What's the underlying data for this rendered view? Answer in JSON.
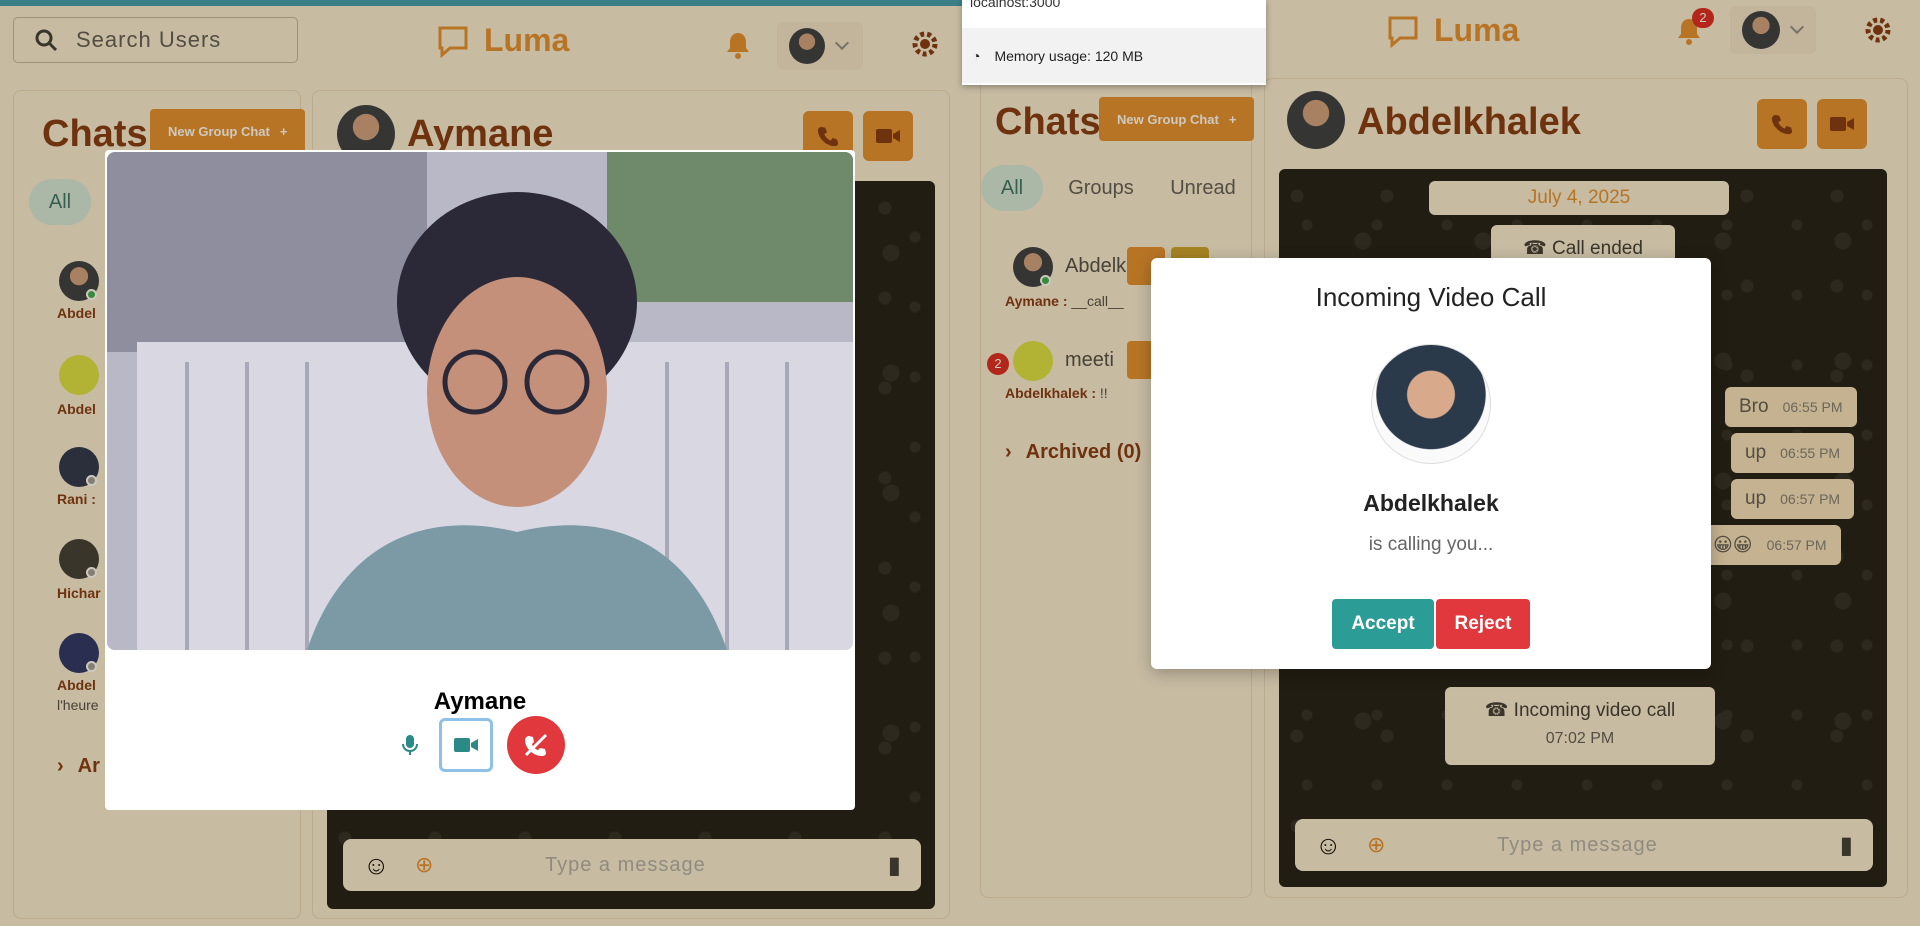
{
  "left": {
    "search_placeholder": "Search Users",
    "app_name": "Luma",
    "chats_title": "Chats",
    "new_group": "New Group Chat",
    "filters": [
      "All"
    ],
    "chat_previews": [
      {
        "name": "Abdel"
      },
      {
        "name": "Abdel"
      },
      {
        "name": "Rani :"
      },
      {
        "name": "Hichar"
      },
      {
        "name": "Abdel",
        "extra": "l'heure"
      }
    ],
    "archived": "Ar",
    "chat_name": "Aymane",
    "composer_placeholder": "Type a message"
  },
  "video_call": {
    "caller": "Aymane"
  },
  "task_popup": {
    "url": "localhost:3000",
    "memory": "Memory usage: 120 MB"
  },
  "right": {
    "app_name": "Luma",
    "notif_count": "2",
    "chats_title": "Chats",
    "new_group": "New Group Chat",
    "filters": [
      "All",
      "Groups",
      "Unread"
    ],
    "items": [
      {
        "name": "Abdelk",
        "sender": "Aymane :",
        "msg": "__call__"
      },
      {
        "name": "meeti",
        "sender": "Abdelkhalek :",
        "msg": "!!",
        "unread": "2"
      }
    ],
    "archived": "Archived (0)",
    "chat_name": "Abdelkhalek",
    "date_pill": "July 4, 2025",
    "call_ended": "Call ended",
    "messages": [
      {
        "text": "Bro",
        "time": "06:55 PM"
      },
      {
        "text": "up",
        "time": "06:55 PM"
      },
      {
        "text": "up",
        "time": "06:57 PM"
      },
      {
        "text": "😀😀",
        "time": "06:57 PM"
      }
    ],
    "incoming_sys": "Incoming video call",
    "incoming_sys_time": "07:02 PM",
    "composer_placeholder": "Type a message"
  },
  "incoming_modal": {
    "title": "Incoming Video Call",
    "caller": "Abdelkhalek",
    "subtitle": "is calling you...",
    "accept": "Accept",
    "reject": "Reject"
  },
  "colors": {
    "accent": "#e08a2c",
    "brand_dark": "#7a2e0c",
    "teal": "#2c9c96",
    "danger": "#e0383c"
  }
}
